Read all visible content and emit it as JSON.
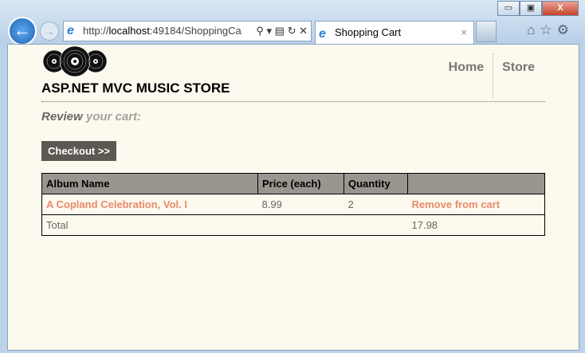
{
  "browser": {
    "url_prefix": "http://",
    "url_host": "localhost",
    "url_rest": ":49184/ShoppingCa",
    "tab_title": "Shopping Cart",
    "window_buttons": {
      "minimize": "▭",
      "maximize": "▣",
      "close": "X"
    }
  },
  "site": {
    "title": "ASP.NET MVC MUSIC STORE",
    "nav": [
      "Home",
      "Store"
    ]
  },
  "page": {
    "review_bold": "Review",
    "review_rest": "your cart:",
    "checkout_label": "Checkout >>"
  },
  "cart": {
    "headers": [
      "Album Name",
      "Price (each)",
      "Quantity",
      ""
    ],
    "items": [
      {
        "album": "A Copland Celebration, Vol. I",
        "price": "8.99",
        "quantity": "2",
        "remove": "Remove from cart"
      }
    ],
    "total_label": "Total",
    "total": "17.98"
  },
  "colors": {
    "link": "#e88a6b",
    "header_bg": "#99968f",
    "page_bg": "#fcf9ee",
    "button_bg": "#5c5852"
  }
}
